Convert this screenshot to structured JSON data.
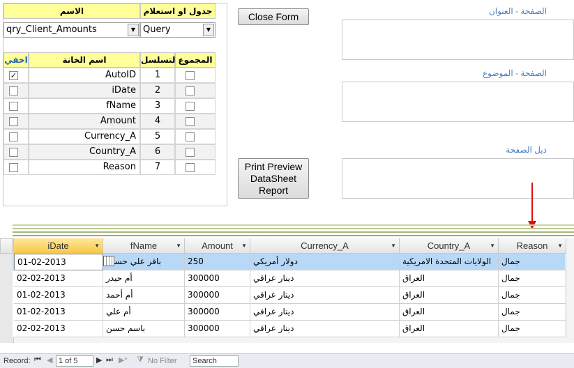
{
  "selector": {
    "name_header": "الاسم",
    "type_header": "جدول او استعلام",
    "name_value": "qry_Client_Amounts",
    "type_value": "Query",
    "col_hide": "اخفي",
    "col_field": "اسم الخانة",
    "col_seq": "التسلسل",
    "col_total": "المجموع",
    "rows": [
      {
        "field": "AutoID",
        "seq": "1",
        "hide": true
      },
      {
        "field": "iDate",
        "seq": "2",
        "hide": false
      },
      {
        "field": "fName",
        "seq": "3",
        "hide": false
      },
      {
        "field": "Amount",
        "seq": "4",
        "hide": false
      },
      {
        "field": "Currency_A",
        "seq": "5",
        "hide": false
      },
      {
        "field": "Country_A",
        "seq": "6",
        "hide": false
      },
      {
        "field": "Reason",
        "seq": "7",
        "hide": false
      }
    ]
  },
  "buttons": {
    "close": "Close Form",
    "print_line1": "Print Preview",
    "print_line2": "DataSheet",
    "print_line3": "Report"
  },
  "labels": {
    "title": "الصفحة - العنوان",
    "subject": "الصفحة - الموضوع",
    "footer": "ذيل الصفحة"
  },
  "datasheet": {
    "columns": [
      "iDate",
      "fName",
      "Amount",
      "Currency_A",
      "Country_A",
      "Reason"
    ],
    "rows": [
      [
        "01-02-2013",
        "باقر علي حسين",
        "250",
        "دولار أمريكي",
        "الولايات المتحدة الامريكية",
        "جمال"
      ],
      [
        "02-02-2013",
        "أم حيدر",
        "300000",
        "دينار عراقي",
        "العراق",
        "جمال"
      ],
      [
        "01-02-2013",
        "أم أحمد",
        "300000",
        "دينار عراقي",
        "العراق",
        "جمال"
      ],
      [
        "01-02-2013",
        "أم علي",
        "300000",
        "دينار عراقي",
        "العراق",
        "جمال"
      ],
      [
        "02-02-2013",
        "باسم حسن",
        "300000",
        "دينار عراقي",
        "العراق",
        "جمال"
      ]
    ]
  },
  "status": {
    "record_label": "Record:",
    "record_pos": "1 of 5",
    "filter": "No Filter",
    "search": "Search"
  },
  "colors": {
    "header_yellow": "#ffff99",
    "label_blue": "#4a7fc1",
    "selected_row": "#b8d8f8",
    "arrow_red": "#dd1111"
  }
}
